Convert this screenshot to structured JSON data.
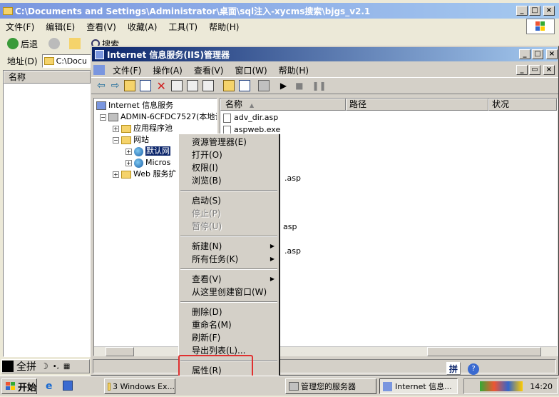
{
  "explorer": {
    "title": "C:\\Documents and Settings\\Administrator\\桌面\\sql注入-xycms搜索\\bjgs_v2.1",
    "menu": [
      "文件(F)",
      "编辑(E)",
      "查看(V)",
      "收藏(A)",
      "工具(T)",
      "帮助(H)"
    ],
    "back_label": "后退",
    "search_label": "搜索",
    "folders_label": "文件夹",
    "address_label": "地址(D)",
    "address_value": "C:\\Docu",
    "name_col": "名称"
  },
  "iis": {
    "title": "Internet 信息服务(IIS)管理器",
    "menu": [
      "文件(F)",
      "操作(A)",
      "查看(V)",
      "窗口(W)",
      "帮助(H)"
    ],
    "tree": {
      "root": "Internet 信息服务",
      "server": "ADMIN-6CFDC7527(本地计",
      "app_pools": "应用程序池",
      "websites": "网站",
      "default_site": "默认网",
      "micros": "Micros",
      "web_ext": "Web 服务扩"
    },
    "columns": [
      "名称",
      "路径",
      "状况"
    ],
    "files": [
      "adv_dir.asp",
      "aspweb.exe",
      ".asp",
      "asp",
      ".asp"
    ]
  },
  "context_menu": {
    "items": [
      {
        "label": "资源管理器(E)",
        "disabled": false
      },
      {
        "label": "打开(O)",
        "disabled": false
      },
      {
        "label": "权限(I)",
        "disabled": false
      },
      {
        "label": "浏览(B)",
        "disabled": false
      },
      {
        "sep": true
      },
      {
        "label": "启动(S)",
        "disabled": false
      },
      {
        "label": "停止(P)",
        "disabled": true
      },
      {
        "label": "暂停(U)",
        "disabled": true
      },
      {
        "sep": true
      },
      {
        "label": "新建(N)",
        "disabled": false,
        "submenu": true
      },
      {
        "label": "所有任务(K)",
        "disabled": false,
        "submenu": true
      },
      {
        "sep": true
      },
      {
        "label": "查看(V)",
        "disabled": false,
        "submenu": true
      },
      {
        "label": "从这里创建窗口(W)",
        "disabled": false
      },
      {
        "sep": true
      },
      {
        "label": "删除(D)",
        "disabled": false
      },
      {
        "label": "重命名(M)",
        "disabled": false
      },
      {
        "label": "刷新(F)",
        "disabled": false
      },
      {
        "label": "导出列表(L)...",
        "disabled": false
      },
      {
        "sep": true
      },
      {
        "label": "属性(R)",
        "disabled": false,
        "highlighted": true
      },
      {
        "sep": true
      },
      {
        "label": "帮助(H)",
        "disabled": false
      }
    ]
  },
  "ime": {
    "label": "全拼"
  },
  "taskbar": {
    "start": "开始",
    "tasks": [
      "3 Windows Ex...",
      "管理您的服务器",
      "Internet 信息..."
    ],
    "clock": "14:20",
    "ime_tray": "拼"
  },
  "colors": {
    "highlight_box": "#e03030",
    "selection": "#0a246a"
  }
}
